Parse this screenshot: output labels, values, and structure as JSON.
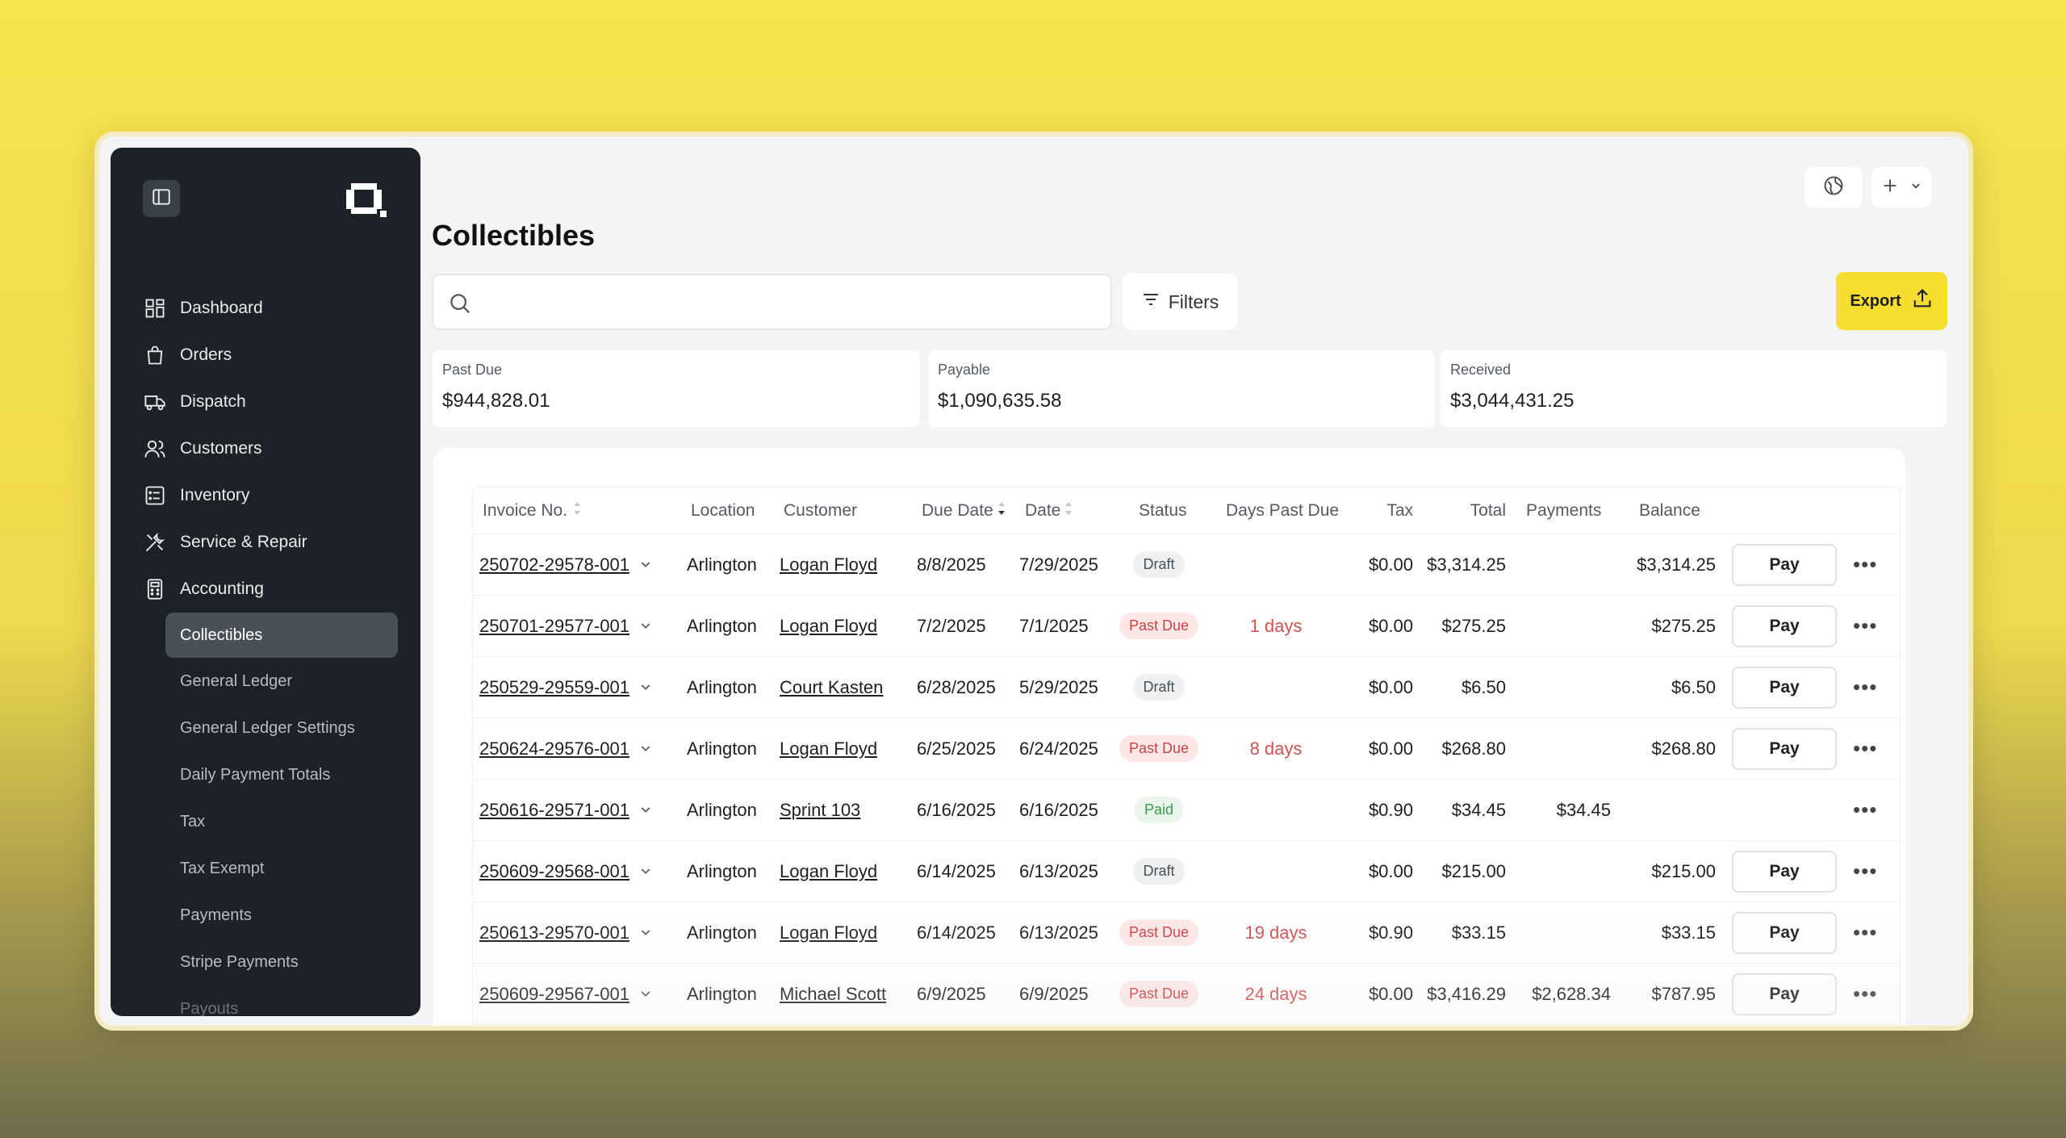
{
  "app": {
    "page_title": "Collectibles"
  },
  "sidebar": {
    "nav": [
      {
        "label": "Dashboard",
        "icon": "dashboard-icon"
      },
      {
        "label": "Orders",
        "icon": "bag-icon"
      },
      {
        "label": "Dispatch",
        "icon": "truck-icon"
      },
      {
        "label": "Customers",
        "icon": "users-icon"
      },
      {
        "label": "Inventory",
        "icon": "list-icon"
      },
      {
        "label": "Service & Repair",
        "icon": "tools-icon"
      },
      {
        "label": "Accounting",
        "icon": "calculator-icon"
      }
    ],
    "accounting_sub": [
      {
        "label": "Collectibles",
        "active": true
      },
      {
        "label": "General Ledger"
      },
      {
        "label": "General Ledger Settings"
      },
      {
        "label": "Daily Payment Totals"
      },
      {
        "label": "Tax"
      },
      {
        "label": "Tax Exempt"
      },
      {
        "label": "Payments"
      },
      {
        "label": "Stripe Payments"
      },
      {
        "label": "Payouts"
      }
    ]
  },
  "toolbar": {
    "search_placeholder": "",
    "filters_label": "Filters",
    "export_label": "Export"
  },
  "stats": {
    "past_due": {
      "label": "Past Due",
      "value": "$944,828.01"
    },
    "payable": {
      "label": "Payable",
      "value": "$1,090,635.58"
    },
    "received": {
      "label": "Received",
      "value": "$3,044,431.25"
    }
  },
  "table": {
    "headers": {
      "invoice": "Invoice No.",
      "location": "Location",
      "customer": "Customer",
      "due_date": "Due Date",
      "date": "Date",
      "status": "Status",
      "days_past_due": "Days Past Due",
      "tax": "Tax",
      "total": "Total",
      "payments": "Payments",
      "balance": "Balance"
    },
    "pay_label": "Pay",
    "rows": [
      {
        "invoice": "250702-29578-001",
        "location": "Arlington",
        "customer": "Logan Floyd",
        "due_date": "8/8/2025",
        "date": "7/29/2025",
        "status": "Draft",
        "days": "",
        "tax": "$0.00",
        "total": "$3,314.25",
        "payments": "",
        "balance": "$3,314.25",
        "pay": true
      },
      {
        "invoice": "250701-29577-001",
        "location": "Arlington",
        "customer": "Logan Floyd",
        "due_date": "7/2/2025",
        "date": "7/1/2025",
        "status": "Past Due",
        "days": "1 days",
        "tax": "$0.00",
        "total": "$275.25",
        "payments": "",
        "balance": "$275.25",
        "pay": true
      },
      {
        "invoice": "250529-29559-001",
        "location": "Arlington",
        "customer": "Court Kasten",
        "due_date": "6/28/2025",
        "date": "5/29/2025",
        "status": "Draft",
        "days": "",
        "tax": "$0.00",
        "total": "$6.50",
        "payments": "",
        "balance": "$6.50",
        "pay": true
      },
      {
        "invoice": "250624-29576-001",
        "location": "Arlington",
        "customer": "Logan Floyd",
        "due_date": "6/25/2025",
        "date": "6/24/2025",
        "status": "Past Due",
        "days": "8 days",
        "tax": "$0.00",
        "total": "$268.80",
        "payments": "",
        "balance": "$268.80",
        "pay": true
      },
      {
        "invoice": "250616-29571-001",
        "location": "Arlington",
        "customer": "Sprint 103",
        "due_date": "6/16/2025",
        "date": "6/16/2025",
        "status": "Paid",
        "days": "",
        "tax": "$0.90",
        "total": "$34.45",
        "payments": "$34.45",
        "balance": "",
        "pay": false
      },
      {
        "invoice": "250609-29568-001",
        "location": "Arlington",
        "customer": "Logan Floyd",
        "due_date": "6/14/2025",
        "date": "6/13/2025",
        "status": "Draft",
        "days": "",
        "tax": "$0.00",
        "total": "$215.00",
        "payments": "",
        "balance": "$215.00",
        "pay": true
      },
      {
        "invoice": "250613-29570-001",
        "location": "Arlington",
        "customer": "Logan Floyd",
        "due_date": "6/14/2025",
        "date": "6/13/2025",
        "status": "Past Due",
        "days": "19 days",
        "tax": "$0.90",
        "total": "$33.15",
        "payments": "",
        "balance": "$33.15",
        "pay": true
      },
      {
        "invoice": "250609-29567-001",
        "location": "Arlington",
        "customer": "Michael Scott",
        "due_date": "6/9/2025",
        "date": "6/9/2025",
        "status": "Past Due",
        "days": "24 days",
        "tax": "$0.00",
        "total": "$3,416.29",
        "payments": "$2,628.34",
        "balance": "$787.95",
        "pay": true
      }
    ]
  }
}
